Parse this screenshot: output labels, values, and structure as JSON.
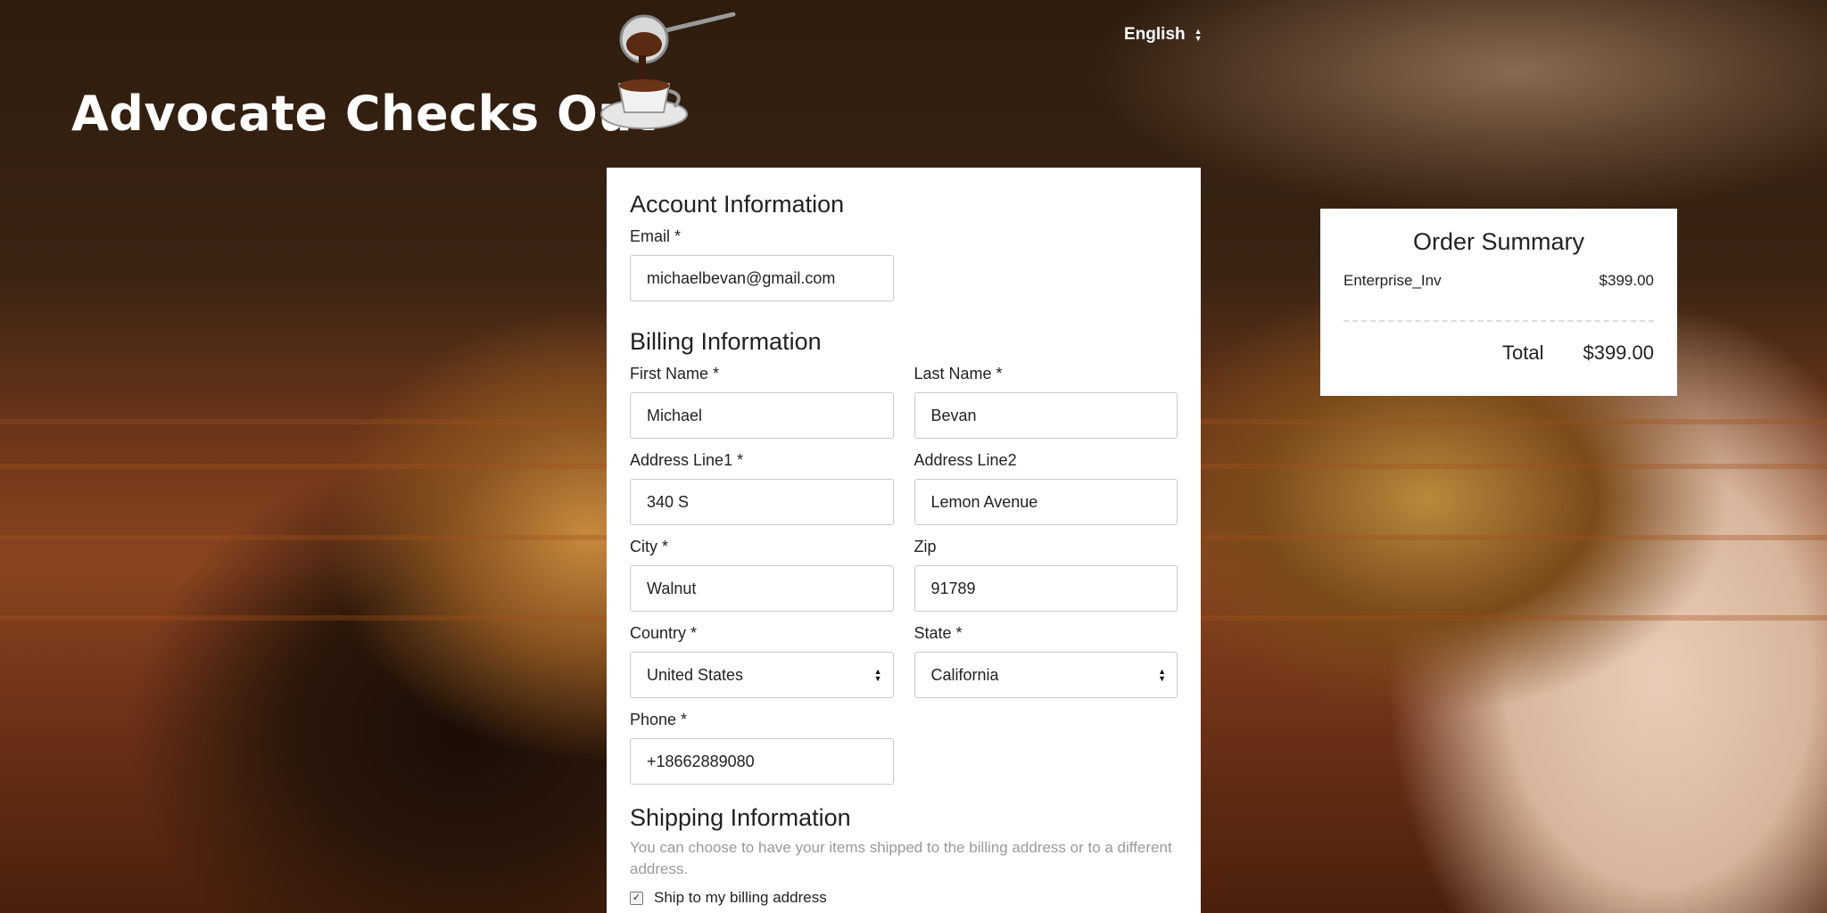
{
  "header": {
    "title": "Advocate Checks Out",
    "language": "English"
  },
  "account": {
    "title": "Account Information",
    "email_label": "Email *",
    "email_value": "michaelbevan@gmail.com"
  },
  "billing": {
    "title": "Billing Information",
    "first_name_label": "First Name *",
    "first_name_value": "Michael",
    "last_name_label": "Last Name *",
    "last_name_value": "Bevan",
    "address1_label": "Address Line1 *",
    "address1_value": "340 S",
    "address2_label": "Address Line2",
    "address2_value": "Lemon Avenue",
    "city_label": "City *",
    "city_value": "Walnut",
    "zip_label": "Zip",
    "zip_value": "91789",
    "country_label": "Country *",
    "country_value": "United States",
    "state_label": "State *",
    "state_value": "California",
    "phone_label": "Phone *",
    "phone_value": "+18662889080"
  },
  "shipping": {
    "title": "Shipping Information",
    "help": "You can choose to have your items shipped to the billing address or to a different address.",
    "checkbox_label": "Ship to my billing address",
    "checkbox_checked": true
  },
  "summary": {
    "title": "Order Summary",
    "item_name": "Enterprise_Inv",
    "item_price": "$399.00",
    "total_label": "Total",
    "total_value": "$399.00"
  },
  "icons": {
    "logo": "coffee-pour-icon",
    "language_toggle": "sort-arrows-icon",
    "select_toggle": "sort-arrows-icon"
  },
  "colors": {
    "card_bg": "#ffffff",
    "help_text": "#9a9a9a",
    "input_border": "#c9c9c9"
  }
}
